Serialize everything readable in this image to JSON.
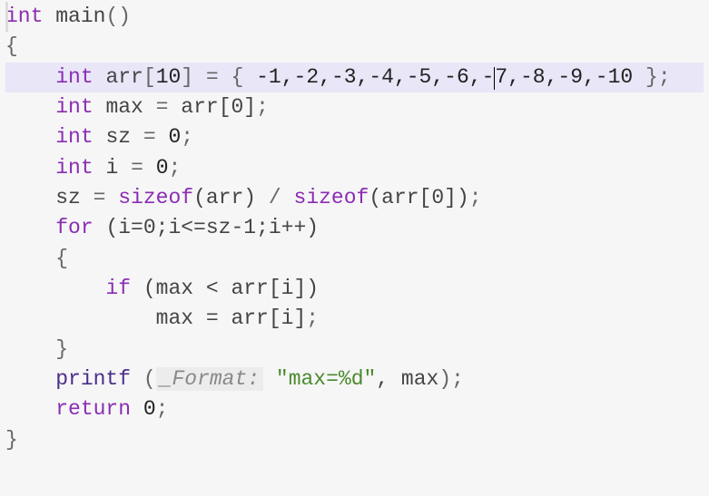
{
  "code": {
    "kw_int": "int",
    "kw_sizeof": "sizeof",
    "kw_for": "for",
    "kw_if": "if",
    "kw_return": "return",
    "main": "main",
    "arr": "arr",
    "max": "max",
    "sz": "sz",
    "i_var": "i",
    "printf": "printf",
    "lbrack": "[",
    "rbrack": "]",
    "lparen": "(",
    "rparen": "()",
    "lbrace": "{",
    "rbrace": "}",
    "semi": ";",
    "eq": " = ",
    "n10": "10",
    "n0": "0",
    "init_open": " = { ",
    "init_close": " }",
    "values_a": "-1,-2,-3,-4,-5,-6,-",
    "values_b": "7,-8,-9,-10",
    "arr0": "arr[0]",
    "sz_expr_left": "(arr)",
    "sz_expr_right": "(arr[0])",
    "div": " / ",
    "for_head": " (i=0;i<=sz-1;i++)",
    "if_cond": " (max < arr[i])",
    "assign_max": "max = arr[i]",
    "hint_format": "_Format:",
    "fmt_str": "\"max=%d\"",
    "comma_sp": ", ",
    "sp_lp": " (",
    "rp": ")"
  }
}
